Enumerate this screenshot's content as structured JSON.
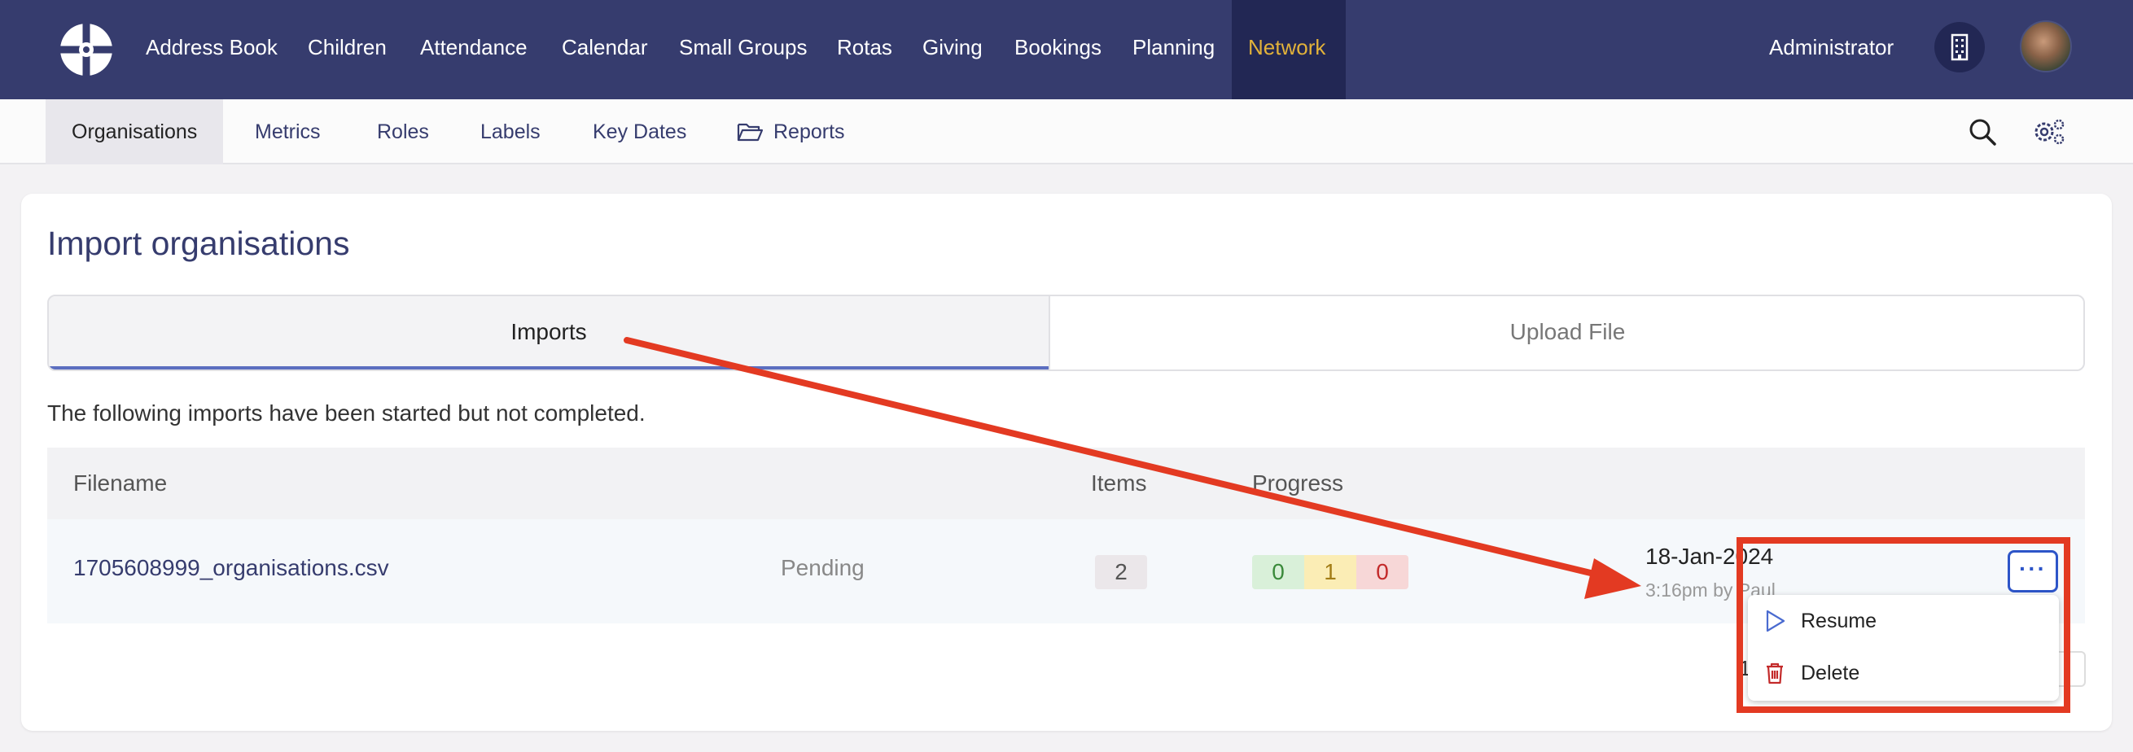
{
  "nav": {
    "items": [
      "Address Book",
      "Children",
      "Attendance",
      "Calendar",
      "Small Groups",
      "Rotas",
      "Giving",
      "Bookings",
      "Planning",
      "Network"
    ],
    "active": "Network",
    "user": "Administrator",
    "active_color": "#e2b23a",
    "bg_color": "#363c6e"
  },
  "subnav": {
    "items": [
      "Organisations",
      "Metrics",
      "Roles",
      "Labels",
      "Key Dates",
      "Reports"
    ],
    "active": "Organisations"
  },
  "page": {
    "title": "Import organisations",
    "tabs": [
      "Imports",
      "Upload File"
    ],
    "active_tab": "Imports",
    "intro": "The following imports have been started but not completed."
  },
  "table": {
    "headers": [
      "Filename",
      "Items",
      "Progress"
    ],
    "rows": [
      {
        "filename": "1705608999_organisations.csv",
        "status": "Pending",
        "items": "2",
        "progress": [
          "0",
          "1",
          "0"
        ],
        "date": "18-Jan-2024",
        "byline": "3:16pm by Paul"
      }
    ]
  },
  "pager": {
    "page": "1"
  },
  "menu": {
    "items": [
      {
        "label": "Resume",
        "icon": "play-icon"
      },
      {
        "label": "Delete",
        "icon": "trash-icon"
      }
    ]
  },
  "annotation": {
    "color": "#e33a22"
  }
}
